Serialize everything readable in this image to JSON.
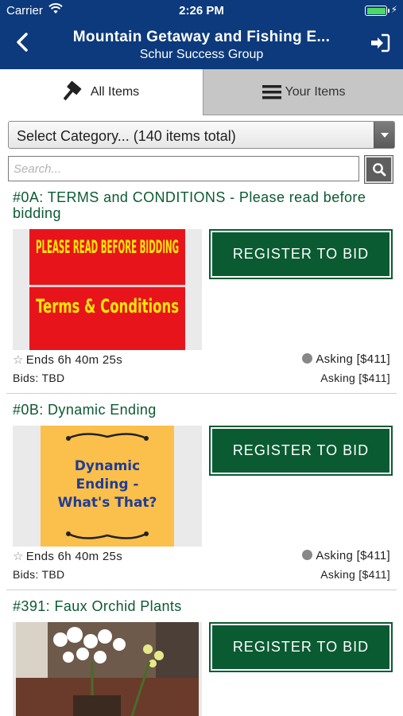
{
  "status_bar": {
    "carrier": "Carrier",
    "time": "2:26 PM"
  },
  "header": {
    "title": "Mountain Getaway and Fishing E...",
    "subtitle": "Schur Success Group"
  },
  "tabs": [
    {
      "label": "All Items"
    },
    {
      "label": "Your Items"
    }
  ],
  "category": {
    "selected": "Select Category... (140 items total)"
  },
  "search": {
    "placeholder": "Search..."
  },
  "items": [
    {
      "title": "#0A: TERMS and CONDITIONS - Please read before bidding",
      "image_text": {
        "top": "PLEASE READ BEFORE BIDDING",
        "bottom": "Terms & Conditions"
      },
      "button_label": "REGISTER TO BID",
      "ends": "Ends 6h 40m 25s",
      "asking_primary": "Asking [$411]",
      "bids": "Bids: TBD",
      "asking_secondary": "Asking [$411]"
    },
    {
      "title": "#0B: Dynamic Ending",
      "image_text": {
        "main": "Dynamic Ending - What's That?"
      },
      "button_label": "REGISTER TO BID",
      "ends": "Ends 6h 40m 25s",
      "asking_primary": "Asking [$411]",
      "bids": "Bids: TBD",
      "asking_secondary": "Asking [$411]"
    },
    {
      "title": "#391: Faux Orchid Plants",
      "button_label": "REGISTER TO BID"
    }
  ],
  "colors": {
    "header": "#0c3a7c",
    "accent_green": "#0a5b32",
    "title_green": "#0c5a34"
  }
}
